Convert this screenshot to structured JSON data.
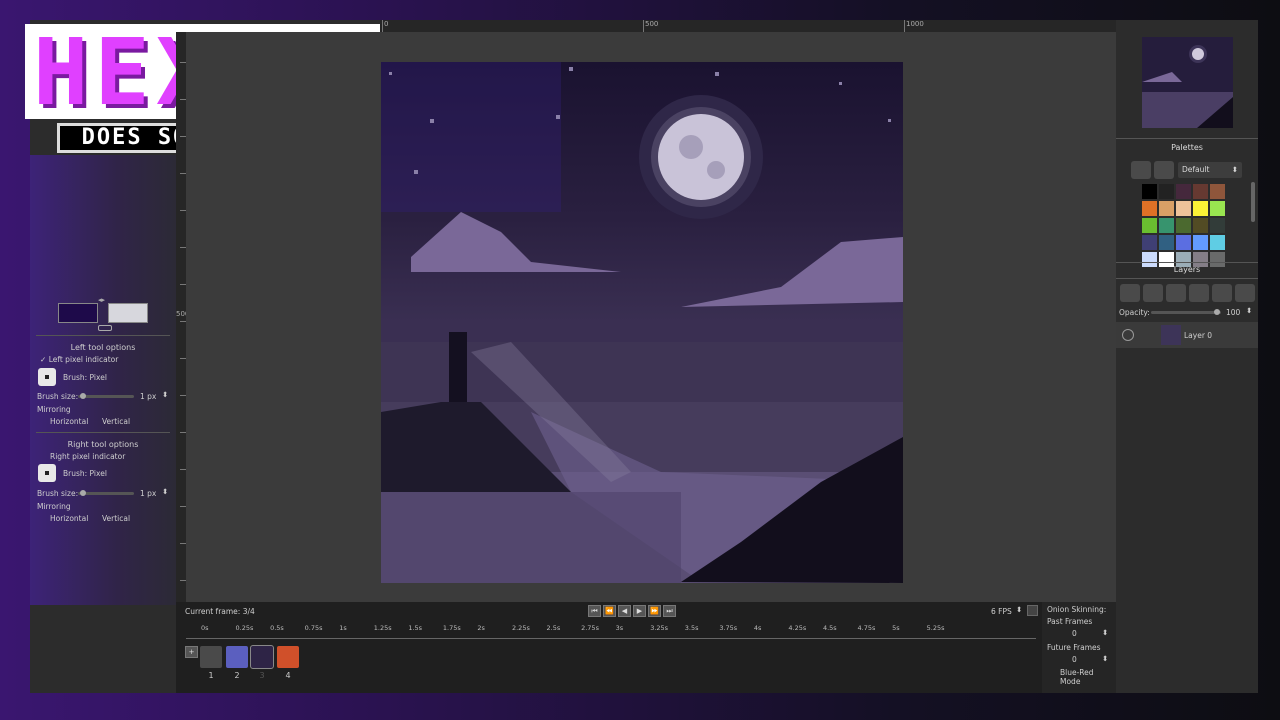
{
  "branding": {
    "logo_text": "HEXDSL",
    "tagline": "DOES SOME LINUX"
  },
  "left": {
    "left_tool_title": "Left tool options",
    "left_pixel_indicator": "Left pixel indicator",
    "left_brush": "Brush: Pixel",
    "brush_size_label": "Brush size:",
    "brush_size_value": "1 px",
    "mirroring": "Mirroring",
    "horizontal": "Horizontal",
    "vertical": "Vertical",
    "right_tool_title": "Right tool options",
    "right_pixel_indicator": "Right pixel indicator",
    "right_brush": "Brush: Pixel",
    "primary_color": "#1e0a4a",
    "secondary_color": "#d7d7dd",
    "checkmark": "✓"
  },
  "rulers": {
    "top": [
      "0",
      "500",
      "1000"
    ],
    "left": [
      "500"
    ]
  },
  "right": {
    "palettes_title": "Palettes",
    "palette_selected": "Default",
    "layers_title": "Layers",
    "opacity_label": "Opacity:",
    "opacity_value": "100",
    "layer_name": "Layer 0",
    "palette_colors": [
      "#000000",
      "#222222",
      "#45283c",
      "#663931",
      "#8f563b",
      "#df7126",
      "#d9a066",
      "#eec39a",
      "#fbf236",
      "#99e550",
      "#6abe30",
      "#37946e",
      "#4b692f",
      "#524b24",
      "#323c39",
      "#3f3f74",
      "#306082",
      "#5b6ee1",
      "#639bff",
      "#5fcde4",
      "#cbdbfc",
      "#ffffff",
      "#9badb7",
      "#847e87",
      "#696a6a"
    ]
  },
  "timeline": {
    "current_frame": "Current frame: 3/4",
    "fps": "6 FPS",
    "time_marks": [
      "0s",
      "0.25s",
      "0.5s",
      "0.75s",
      "1s",
      "1.25s",
      "1.5s",
      "1.75s",
      "2s",
      "2.25s",
      "2.5s",
      "2.75s",
      "3s",
      "3.25s",
      "3.5s",
      "3.75s",
      "4s",
      "4.25s",
      "4.5s",
      "4.75s",
      "5s",
      "5.25s"
    ],
    "frames": [
      "1",
      "2",
      "3",
      "4"
    ],
    "add_label": "+"
  },
  "onion": {
    "title": "Onion Skinning:",
    "past": "Past Frames",
    "past_value": "0",
    "future": "Future Frames",
    "future_value": "0",
    "mode": "Blue-Red Mode"
  }
}
